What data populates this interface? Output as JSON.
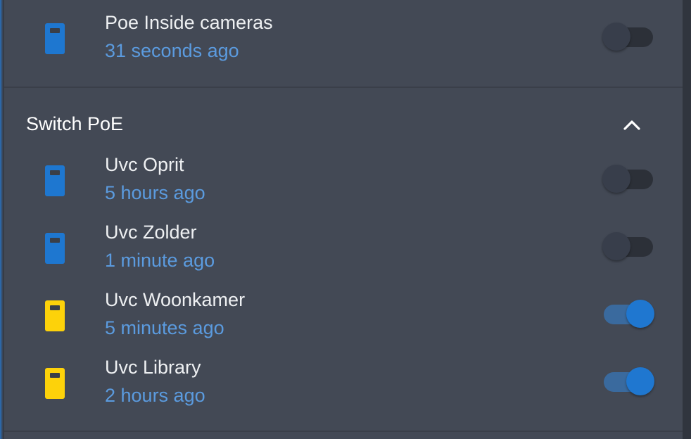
{
  "top_item": {
    "name": "Poe Inside cameras",
    "last_changed": "31 seconds ago",
    "icon": "phone-device-icon",
    "icon_color": "#1e77d0",
    "state": "off"
  },
  "section": {
    "title": "Switch PoE",
    "expanded": true,
    "collapse_icon": "chevron-up-icon",
    "items": [
      {
        "name": "Uvc Oprit",
        "last_changed": "5 hours ago",
        "icon": "phone-device-icon",
        "icon_color": "#1e77d0",
        "state": "off"
      },
      {
        "name": "Uvc Zolder",
        "last_changed": "1 minute ago",
        "icon": "phone-device-icon",
        "icon_color": "#1e77d0",
        "state": "off"
      },
      {
        "name": "Uvc Woonkamer",
        "last_changed": "5 minutes ago",
        "icon": "phone-device-icon",
        "icon_color": "#fdd20a",
        "state": "on"
      },
      {
        "name": "Uvc Library",
        "last_changed": "2 hours ago",
        "icon": "phone-device-icon",
        "icon_color": "#fdd20a",
        "state": "on"
      }
    ]
  },
  "colors": {
    "card_background": "#434955",
    "primary_text": "#eef0f2",
    "secondary_text": "#5b9bdf",
    "accent_on": "#1f77d0",
    "toggle_off_knob": "#383e4b"
  }
}
